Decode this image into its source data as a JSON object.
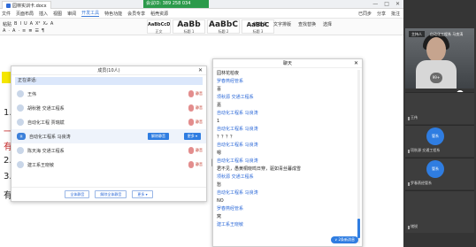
{
  "window": {
    "doc_tab": "园林实训卡.docx",
    "meeting_id": "会议ID: 389 258 034",
    "min": "—",
    "max": "□",
    "close": "✕"
  },
  "menu": {
    "items": [
      "文件",
      "页面布局",
      "插入",
      "视图",
      "审阅",
      "开发工具",
      "特色功能",
      "会员专享",
      "稻壳资源"
    ],
    "right": [
      "已同步",
      "分享",
      "批注"
    ],
    "active_index": 5
  },
  "ribbon": {
    "row1": [
      "粘贴",
      "B",
      "I",
      "U",
      "A",
      "X²",
      "X₂",
      "A"
    ],
    "row2": [
      "A",
      "·",
      "A",
      "·",
      "≡",
      "≣",
      "☰",
      "¶"
    ],
    "styles": [
      {
        "big": "AaBbCcDd",
        "small": "正文"
      },
      {
        "big": "AaBb",
        "small": "标题 1"
      },
      {
        "big": "AaBbC",
        "small": "标题 2"
      },
      {
        "big": "AaBbC",
        "small": "标题 3"
      }
    ],
    "right": [
      "新样式",
      "文字排版",
      "查找替换",
      "选择"
    ]
  },
  "document": {
    "num1": "1.",
    "num2": "2.",
    "num3": "3.",
    "c1": "一",
    "c2": "有",
    "c3": "有",
    "c4": "自"
  },
  "members": {
    "title": "成员(10人)",
    "close": "✕",
    "speaking": "正在讲话:",
    "rows": [
      {
        "name": "王伟",
        "mic": "静音"
      },
      {
        "name": "胡秋雅 交通工程系",
        "mic": "静音"
      },
      {
        "name": "自动化工程 贾瑞斌",
        "mic": "静音"
      },
      {
        "name": "自动化工程系 马良涛",
        "host": "我",
        "btn1": "解除静音",
        "btn2": "更多 ▾"
      },
      {
        "name": "陈天海 交通工程系",
        "mic": "静音"
      },
      {
        "name": "建工系王晓敏",
        "mic": "静音"
      }
    ],
    "footer": [
      "全体静音",
      "解除全体静音",
      "更多 ▾"
    ]
  },
  "chat": {
    "title": "聊天",
    "close": "✕",
    "messages": [
      {
        "type": "body",
        "text": "园林花柏夜"
      },
      {
        "type": "name",
        "text": "罗春燕经管系"
      },
      {
        "type": "body",
        "text": "喜"
      },
      {
        "type": "name",
        "text": "项秋源 交通工程系"
      },
      {
        "type": "body",
        "text": "嘉"
      },
      {
        "type": "name",
        "text": "自动化工程系 马良涛"
      },
      {
        "type": "body",
        "text": "1"
      },
      {
        "type": "name",
        "text": "自动化工程系 马良涛"
      },
      {
        "type": "body",
        "text": "？？？？"
      },
      {
        "type": "name",
        "text": "自动化工程系 马良涛"
      },
      {
        "type": "body",
        "text": "嗯"
      },
      {
        "type": "name",
        "text": "自动化工程系 马良涛"
      },
      {
        "type": "body",
        "text": "君不见，愚黄桐晓鸣日穿，驱如青丝暮成雪"
      },
      {
        "type": "name",
        "text": "项秋源 交通工程系"
      },
      {
        "type": "body",
        "text": "愁"
      },
      {
        "type": "name",
        "text": "自动化工程系 马良涛"
      },
      {
        "type": "body",
        "text": "NO"
      },
      {
        "type": "name",
        "text": "罗春燕经管系"
      },
      {
        "type": "body",
        "text": "窝"
      },
      {
        "type": "name",
        "text": "建工系王晓敏"
      }
    ],
    "new_messages": "∨ 2条新消息"
  },
  "video": {
    "main_label": "自动化工程系 马良涛",
    "tag": "主持人",
    "stats": "99+",
    "tiles": [
      {
        "name": "王伟",
        "circle": ""
      },
      {
        "name": "项秋源 交通工程系",
        "circle": "管系"
      },
      {
        "name": "罗春燕经管系",
        "circle": "管系"
      },
      {
        "name": "储锐",
        "circle": ""
      }
    ]
  }
}
